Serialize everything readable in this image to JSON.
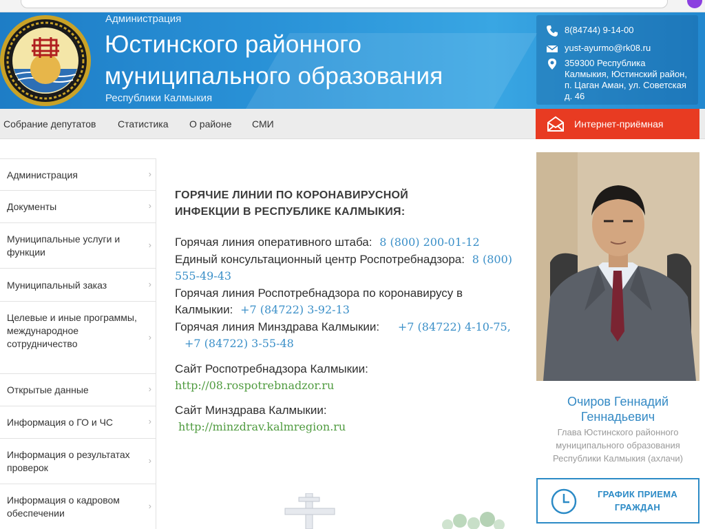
{
  "header": {
    "admin_label": "Администрация",
    "title_line1": "Юстинского районного",
    "title_line2": "муниципального образования",
    "republic_label": "Республики Калмыкия"
  },
  "contacts": {
    "phone": "8(84744) 9-14-00",
    "email": "yust-ayurmo@rk08.ru",
    "address": "359300 Республика Калмыкия, Юстинский район, п. Цаган Аман, ул. Советская д. 46"
  },
  "nav": {
    "items": [
      {
        "label": "Собрание депутатов"
      },
      {
        "label": "Статистика"
      },
      {
        "label": "О районе"
      },
      {
        "label": "СМИ"
      }
    ],
    "reception_label": "Интернет-приёмная"
  },
  "sidebar": {
    "items": [
      {
        "label": "Администрация"
      },
      {
        "label": "Документы"
      },
      {
        "label": "Муниципальные услуги и функции"
      },
      {
        "label": "Муниципальный заказ"
      },
      {
        "label": "Целевые и иные программы, международное сотрудничество"
      },
      {
        "label": "Открытые данные"
      },
      {
        "label": "Информация о ГО и ЧС"
      },
      {
        "label": "Информация о результатах проверок"
      },
      {
        "label": "Информация о кадровом обеспечении"
      }
    ]
  },
  "content": {
    "heading_line1": "ГОРЯЧИЕ ЛИНИИ ПО КОРОНАВИРУСНОЙ",
    "heading_line2": "ИНФЕКЦИИ В РЕСПУБЛИКЕ КАЛМЫКИЯ:",
    "hotline_hq_label": "Горячая линия оперативного штаба:",
    "hotline_hq_phone": "8 (800) 200-01-12",
    "rpn_center_label": "Единый консультационный центр Роспотребнадзора:",
    "rpn_center_phone": "8 (800) 555-49-43",
    "rpn_kalm_label": "Горячая линия Роспотребнадзора по коронавирусу в Калмыкии:",
    "rpn_kalm_phone": "+7 (84722) 3-92-13",
    "minzdrav_label": "Горячая линия Минздрава Калмыкии:",
    "minzdrav_phone1": "+7 (84722) 4-10-75,",
    "minzdrav_phone2": "+7 (84722) 3-55-48",
    "site_rpn_label": "Сайт Роспотребнадзора Калмыкии:",
    "site_rpn_url": "http://08.rospotrebnadzor.ru",
    "site_mz_label": "Сайт Минздрава Калмыкии:",
    "site_mz_url": "http://minzdrav.kalmregion.ru"
  },
  "official": {
    "name_line1": "Очиров Геннадий",
    "name_line2": "Геннадьевич",
    "position": "Глава Юстинского районного муниципального образования Республики Калмыкия (ахлачи)"
  },
  "schedule": {
    "label_line1": "ГРАФИК ПРИЕМА",
    "label_line2": "ГРАЖДАН"
  },
  "colors": {
    "header_blue": "#2a93d8",
    "reception_red": "#e83b22",
    "phone_blue": "#3a8fc8",
    "link_green": "#4f9b3f",
    "schedule_blue": "#2b8ac6"
  }
}
